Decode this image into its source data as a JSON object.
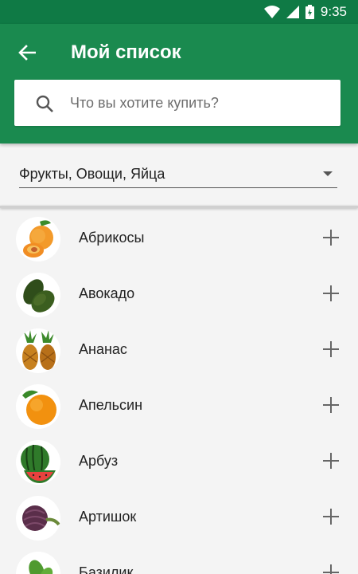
{
  "status": {
    "time": "9:35"
  },
  "header": {
    "title": "Мой список"
  },
  "search": {
    "placeholder": "Что вы хотите купить?"
  },
  "category": {
    "selected": "Фрукты, Овощи, Яйца"
  },
  "items": [
    {
      "name": "Абрикосы",
      "icon": "apricot-icon"
    },
    {
      "name": "Авокадо",
      "icon": "avocado-icon"
    },
    {
      "name": "Ананас",
      "icon": "pineapple-icon"
    },
    {
      "name": "Апельсин",
      "icon": "orange-icon"
    },
    {
      "name": "Арбуз",
      "icon": "watermelon-icon"
    },
    {
      "name": "Артишок",
      "icon": "artichoke-icon"
    },
    {
      "name": "Базилик",
      "icon": "basil-icon"
    }
  ],
  "colors": {
    "primary": "#1a8a4f",
    "statusbar": "#0f7a45"
  }
}
